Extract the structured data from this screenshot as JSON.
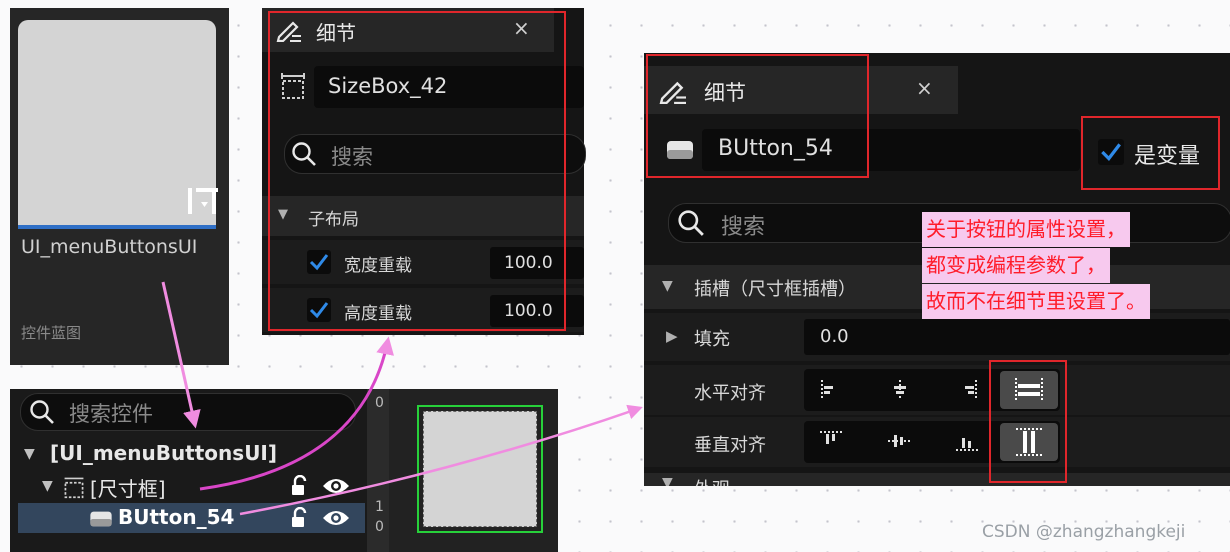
{
  "asset_card": {
    "name": "UI_menuButtonsUI",
    "type_label": "控件蓝图"
  },
  "details_panel_1": {
    "tab_title": "细节",
    "close_glyph": "×",
    "widget_name": "SizeBox_42",
    "search_placeholder": "搜索",
    "section_title": "子布局",
    "width_override_label": "宽度重载",
    "width_override_value": "100.0",
    "width_override_checked": true,
    "height_override_label": "高度重载",
    "height_override_value": "100.0",
    "height_override_checked": true
  },
  "details_panel_2": {
    "tab_title": "细节",
    "close_glyph": "×",
    "widget_name": "BUtton_54",
    "is_variable_label": "是变量",
    "is_variable_checked": true,
    "search_placeholder": "搜索",
    "section_title": "插槽（尺寸框插槽）",
    "padding_label": "填充",
    "padding_value": "0.0",
    "h_align_label": "水平对齐",
    "v_align_label": "垂直对齐",
    "bottom_section_title": "外观"
  },
  "hierarchy": {
    "search_placeholder": "搜索控件",
    "root_label": "[UI_menuButtonsUI]",
    "sizebox_label": "[尺寸框]",
    "button_label": "BUtton_54"
  },
  "designer": {
    "ruler_labels": [
      "0",
      "1",
      "0"
    ]
  },
  "annotation": {
    "lines": [
      "关于按钮的属性设置，",
      "都变成编程参数了，",
      "故而不在细节里设置了。"
    ]
  },
  "watermark": "CSDN @zhangzhangkeji",
  "colors": {
    "annotation_text": "#ff1c2a",
    "annotation_bg": "#f7c9ee",
    "highlight_border": "#e0262b",
    "arrow": "#f08ce0",
    "checkbox_accent": "#2f8ae8",
    "designer_outline": "#27d13a"
  }
}
